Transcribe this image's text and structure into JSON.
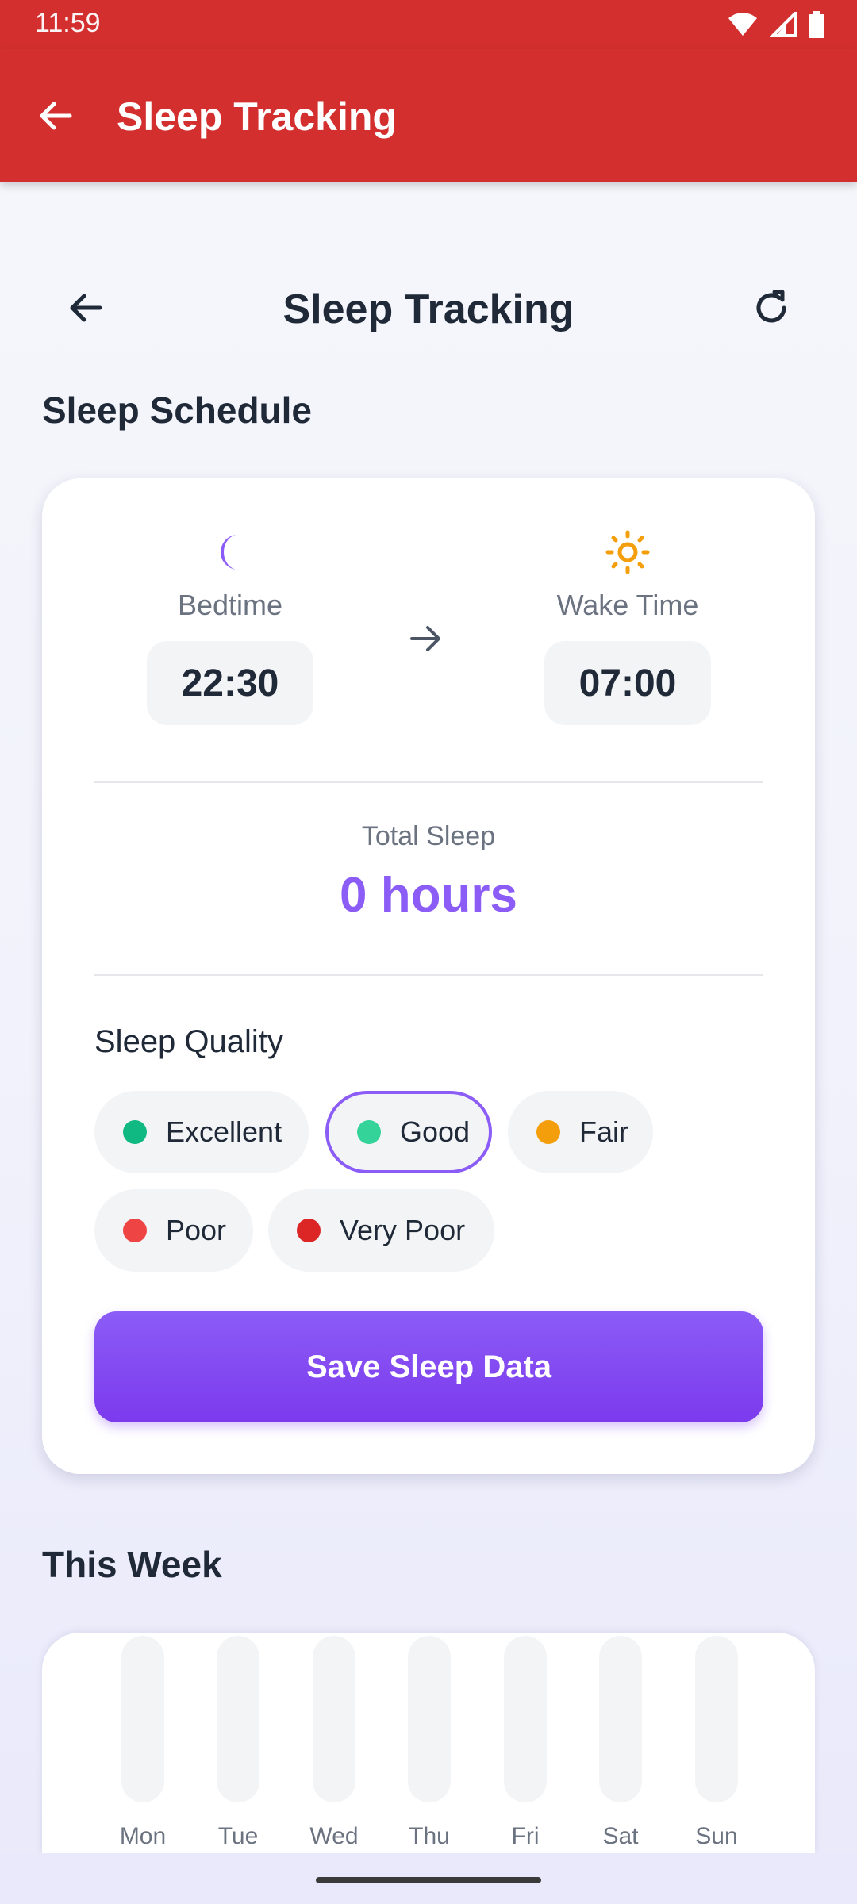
{
  "status": {
    "time": "11:59"
  },
  "appbar": {
    "title": "Sleep Tracking"
  },
  "header": {
    "title": "Sleep Tracking"
  },
  "schedule": {
    "section_title": "Sleep Schedule",
    "bedtime_label": "Bedtime",
    "bedtime_value": "22:30",
    "wake_label": "Wake Time",
    "wake_value": "07:00",
    "total_label": "Total Sleep",
    "total_value": "0 hours",
    "quality_label": "Sleep Quality",
    "quality_options": [
      {
        "label": "Excellent",
        "color": "#10b981",
        "selected": false
      },
      {
        "label": "Good",
        "color": "#34d399",
        "selected": true
      },
      {
        "label": "Fair",
        "color": "#f59e0b",
        "selected": false
      },
      {
        "label": "Poor",
        "color": "#ef4444",
        "selected": false
      },
      {
        "label": "Very Poor",
        "color": "#dc2626",
        "selected": false
      }
    ],
    "save_label": "Save Sleep Data"
  },
  "week": {
    "section_title": "This Week",
    "days": [
      "Mon",
      "Tue",
      "Wed",
      "Thu",
      "Fri",
      "Sat",
      "Sun"
    ]
  },
  "colors": {
    "appbar": "#d32f2f",
    "accent": "#8b5cf6",
    "moon": "#8b5cf6",
    "sun": "#f59e0b"
  }
}
